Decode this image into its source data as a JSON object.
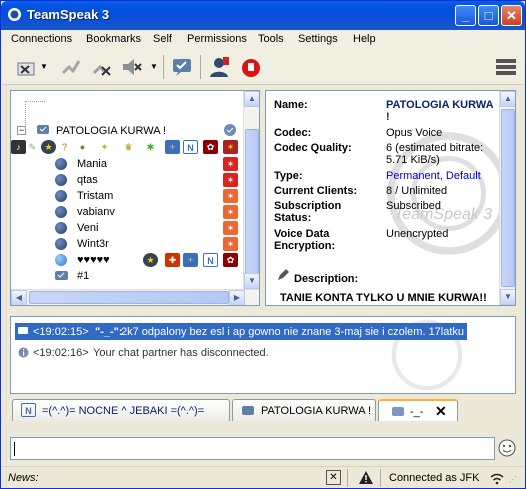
{
  "window": {
    "title": "TeamSpeak 3"
  },
  "menu": [
    "Connections",
    "Bookmarks",
    "Self",
    "Permissions",
    "Tools",
    "Settings",
    "Help"
  ],
  "tree": {
    "channel": "PATOLOGIA KURWA !",
    "clients": [
      "Mania",
      "qtas",
      "Tristam",
      "vabianv",
      "Veni",
      "Wint3r",
      "♥♥♥♥♥",
      "#1"
    ]
  },
  "info": {
    "name_label": "Name:",
    "name": "PATOLOGIA KURWA !",
    "codec_label": "Codec:",
    "codec": "Opus Voice",
    "quality_label": "Codec Quality:",
    "quality": "6 (estimated bitrate: 5.71 KiB/s)",
    "type_label": "Type:",
    "type": "Permanent, Default",
    "clients_label": "Current Clients:",
    "clients": "8 / Unlimited",
    "sub_label": "Subscription Status:",
    "sub": "Subscribed",
    "enc_label": "Voice Data Encryption:",
    "enc": "Unencrypted",
    "desc_label": "Description:",
    "desc": "TANIE KONTA TYLKO U MNIE KURWA!!",
    "watermark": "TeamSpeak 3"
  },
  "chat": {
    "line1_time": "<19:02:15>",
    "line1_user": "\"-_-\":",
    "line1_text": " 2k7 odpalony bez esl i ap  gowno nie znane 3-maj sie i czolem. 17latku",
    "line2_time": "<19:02:16>",
    "line2_text": " Your chat partner has disconnected."
  },
  "tabs": [
    {
      "label": "=(^.^)= NOCNE ^ JEBAKI =(^.^)="
    },
    {
      "label": "PATOLOGIA KURWA !"
    },
    {
      "label": "-_-"
    }
  ],
  "status": {
    "news_label": "News:",
    "connection": "Connected as JFK"
  },
  "colors": {
    "accent": "#0a246a",
    "link": "#0000cc",
    "selection": "#316ac5"
  }
}
